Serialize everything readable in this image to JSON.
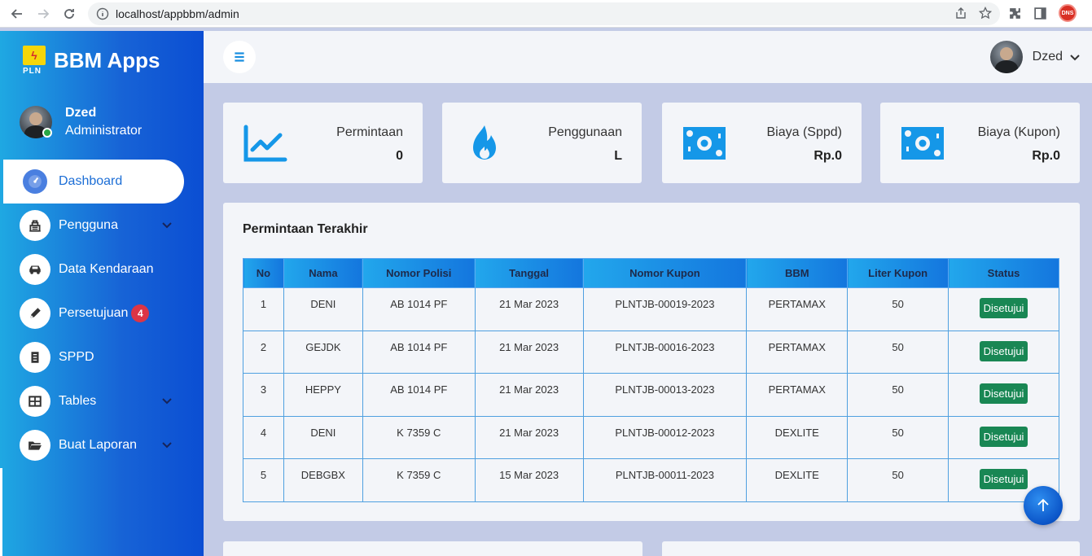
{
  "browser": {
    "url": "localhost/appbbm/admin",
    "extension_badge": "DNS"
  },
  "sidebar": {
    "brand_logo_text": "PLN",
    "brand_title": "BBM Apps",
    "user_name": "Dzed",
    "user_role": "Administrator",
    "items": [
      {
        "label": "Dashboard",
        "icon": "dashboard-icon"
      },
      {
        "label": "Pengguna",
        "icon": "users-icon"
      },
      {
        "label": "Data Kendaraan",
        "icon": "car-icon"
      },
      {
        "label": "Persetujuan",
        "icon": "pencil-icon",
        "badge": "4"
      },
      {
        "label": "SPPD",
        "icon": "document-icon"
      },
      {
        "label": "Tables",
        "icon": "table-icon"
      },
      {
        "label": "Buat Laporan",
        "icon": "folder-icon"
      }
    ]
  },
  "header": {
    "user_name": "Dzed"
  },
  "stats": [
    {
      "label": "Permintaan",
      "value": "0",
      "icon": "chart-line-icon"
    },
    {
      "label": "Penggunaan",
      "value": "L",
      "icon": "fire-icon"
    },
    {
      "label": "Biaya (Sppd)",
      "value": "Rp.0",
      "icon": "money-bill-icon"
    },
    {
      "label": "Biaya (Kupon)",
      "value": "Rp.0",
      "icon": "money-bill-icon"
    }
  ],
  "recent": {
    "title": "Permintaan Terakhir",
    "columns": [
      "No",
      "Nama",
      "Nomor Polisi",
      "Tanggal",
      "Nomor Kupon",
      "BBM",
      "Liter Kupon",
      "Status"
    ],
    "rows": [
      [
        "1",
        "DENI",
        "AB 1014 PF",
        "21 Mar 2023",
        "PLNTJB-00019-2023",
        "PERTAMAX",
        "50",
        "Disetujui"
      ],
      [
        "2",
        "GEJDK",
        "AB 1014 PF",
        "21 Mar 2023",
        "PLNTJB-00016-2023",
        "PERTAMAX",
        "50",
        "Disetujui"
      ],
      [
        "3",
        "HEPPY",
        "AB 1014 PF",
        "21 Mar 2023",
        "PLNTJB-00013-2023",
        "PERTAMAX",
        "50",
        "Disetujui"
      ],
      [
        "4",
        "DENI",
        "K 7359 C",
        "21 Mar 2023",
        "PLNTJB-00012-2023",
        "DEXLITE",
        "50",
        "Disetujui"
      ],
      [
        "5",
        "DEBGBX",
        "K 7359 C",
        "15 Mar 2023",
        "PLNTJB-00011-2023",
        "DEXLITE",
        "50",
        "Disetujui"
      ]
    ]
  },
  "colors": {
    "accent": "#1597e8",
    "sidebar_start": "#1fa8e2",
    "sidebar_end": "#0b4ed3",
    "status_approved": "#198754",
    "badge": "#dc3545"
  }
}
